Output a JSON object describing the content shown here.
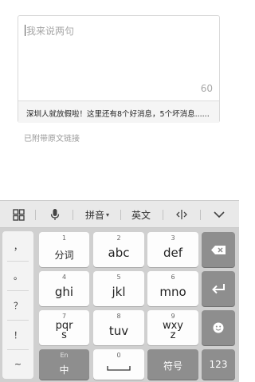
{
  "compose": {
    "placeholder": "我来说两句",
    "char_counter": "60",
    "link_title": "深圳人就放假啦！这里还有8个好消息，5个坏消息......",
    "link_note": "已附带原文链接"
  },
  "keyboard": {
    "toolbar": {
      "grid_icon": "grid-icon",
      "mic_icon": "microphone-icon",
      "pinyin_label": "拼音",
      "english_label": "英文",
      "cursor_icon": "cursor-move-icon",
      "collapse_icon": "chevron-down-icon"
    },
    "side_keys": [
      "，",
      "。",
      "？",
      "！",
      "~"
    ],
    "keys": {
      "k1": {
        "num": "1",
        "label": "分词"
      },
      "k2": {
        "num": "2",
        "label": "abc"
      },
      "k3": {
        "num": "3",
        "label": "def"
      },
      "k4": {
        "num": "4",
        "label": "ghi"
      },
      "k5": {
        "num": "5",
        "label": "jkl"
      },
      "k6": {
        "num": "6",
        "label": "mno"
      },
      "k7": {
        "num": "7",
        "label_top": "pqr",
        "label_bottom": "s"
      },
      "k8": {
        "num": "8",
        "label": "tuv"
      },
      "k9": {
        "num": "9",
        "label_top": "wxy",
        "label_bottom": "z"
      },
      "lang": {
        "num": "En",
        "label": "中"
      },
      "space": {
        "num": "0"
      },
      "symbol": {
        "label": "符号"
      },
      "numeric": {
        "label": "123"
      }
    },
    "action_icons": {
      "delete": "backspace-icon",
      "enter": "enter-icon",
      "emoji": "emoji-icon",
      "space": "space-bar-icon"
    }
  },
  "colors": {
    "keyboard_bg": "#d0d0d0",
    "key_bg": "#fdfdfd",
    "dark_key_bg": "#8e8e8e",
    "toolbar_bg": "#e9e9e9"
  }
}
